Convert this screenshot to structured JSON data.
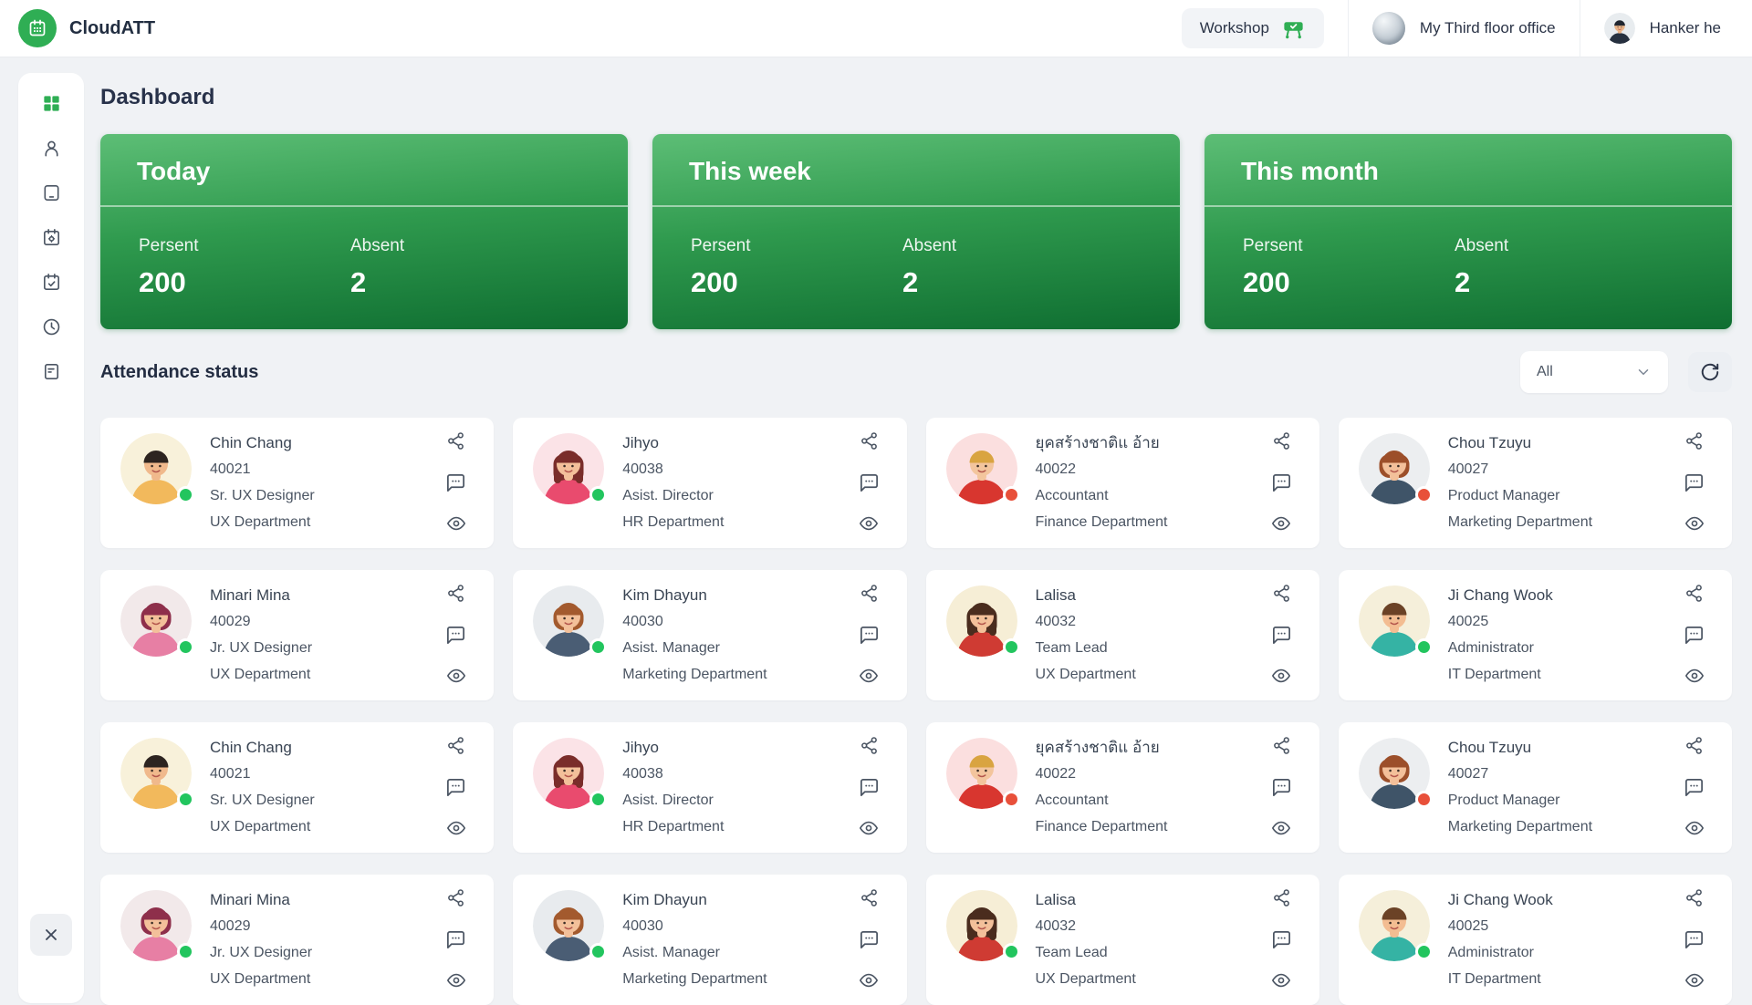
{
  "header": {
    "brand": "CloudATT",
    "workshop_label": "Workshop",
    "office_label": "My Third floor office",
    "user_name": "Hanker he",
    "user_avatar": {
      "bg": "#e8ecef",
      "hair": "#20262f",
      "skin": "#eab489",
      "shirt": "#26303f",
      "style": "short"
    }
  },
  "sidebar": {
    "items": [
      {
        "name": "dashboard",
        "icon": "grid-icon",
        "active": true
      },
      {
        "name": "employees",
        "icon": "user-icon",
        "active": false
      },
      {
        "name": "devices",
        "icon": "tablet-icon",
        "active": false
      },
      {
        "name": "schedule-settings",
        "icon": "calendar-gear-icon",
        "active": false
      },
      {
        "name": "attendance-calendar",
        "icon": "calendar-check-icon",
        "active": false
      },
      {
        "name": "time-log",
        "icon": "clock-icon",
        "active": false
      },
      {
        "name": "reports",
        "icon": "report-icon",
        "active": false
      }
    ],
    "collapse_icon": "close-icon"
  },
  "page_title": "Dashboard",
  "summary_cards": [
    {
      "title": "Today",
      "present_label": "Persent",
      "present_value": "200",
      "absent_label": "Absent",
      "absent_value": "2"
    },
    {
      "title": "This week",
      "present_label": "Persent",
      "present_value": "200",
      "absent_label": "Absent",
      "absent_value": "2"
    },
    {
      "title": "This month",
      "present_label": "Persent",
      "present_value": "200",
      "absent_label": "Absent",
      "absent_value": "2"
    }
  ],
  "attendance": {
    "title": "Attendance status",
    "filter_value": "All",
    "employees": [
      {
        "name": "Chin Chang",
        "id": "40021",
        "role": "Sr. UX Designer",
        "dept": "UX Department",
        "status": "present",
        "avatar": {
          "bg": "#f8f1da",
          "hair": "#2d2420",
          "skin": "#f0b98c",
          "shirt": "#f2b95c",
          "style": "short"
        }
      },
      {
        "name": "Jihyo",
        "id": "40038",
        "role": "Asist. Director",
        "dept": "HR Department",
        "status": "present",
        "avatar": {
          "bg": "#fbe3e7",
          "hair": "#7a2d2a",
          "skin": "#f3c09a",
          "shirt": "#e94b6e",
          "style": "long"
        }
      },
      {
        "name": "ยุคสร้างชาติแ อ้าย",
        "id": "40022",
        "role": "Accountant",
        "dept": "Finance Department",
        "status": "absent",
        "avatar": {
          "bg": "#fbdfdf",
          "hair": "#d9a441",
          "skin": "#f3c59d",
          "shirt": "#d8362f",
          "style": "short"
        }
      },
      {
        "name": "Chou Tzuyu",
        "id": "40027",
        "role": "Product Manager",
        "dept": "Marketing Department",
        "status": "absent",
        "avatar": {
          "bg": "#eceef0",
          "hair": "#9c4f2a",
          "skin": "#f3c09a",
          "shirt": "#3f5468",
          "style": "bob"
        }
      },
      {
        "name": "Minari Mina",
        "id": "40029",
        "role": "Jr. UX Designer",
        "dept": "UX Department",
        "status": "present",
        "avatar": {
          "bg": "#f2e9ea",
          "hair": "#8e2f4b",
          "skin": "#f3c09a",
          "shirt": "#e77fa4",
          "style": "bob"
        }
      },
      {
        "name": "Kim Dhayun",
        "id": "40030",
        "role": "Asist. Manager",
        "dept": "Marketing Department",
        "status": "present",
        "avatar": {
          "bg": "#e8ebee",
          "hair": "#a35a2e",
          "skin": "#f3c09a",
          "shirt": "#4a5d74",
          "style": "bob"
        }
      },
      {
        "name": "Lalisa",
        "id": "40032",
        "role": "Team Lead",
        "dept": "UX Department",
        "status": "present",
        "avatar": {
          "bg": "#f6eed6",
          "hair": "#4a2c1e",
          "skin": "#f3c09a",
          "shirt": "#cf3b33",
          "style": "long"
        }
      },
      {
        "name": "Ji Chang Wook",
        "id": "40025",
        "role": "Administrator",
        "dept": "IT Department",
        "status": "present",
        "avatar": {
          "bg": "#f5efda",
          "hair": "#6b4226",
          "skin": "#f3bd92",
          "shirt": "#35b3a4",
          "style": "short"
        }
      },
      {
        "name": "Chin Chang",
        "id": "40021",
        "role": "Sr. UX Designer",
        "dept": "UX Department",
        "status": "present",
        "avatar": {
          "bg": "#f8f1da",
          "hair": "#2d2420",
          "skin": "#f0b98c",
          "shirt": "#f2b95c",
          "style": "short"
        }
      },
      {
        "name": "Jihyo",
        "id": "40038",
        "role": "Asist. Director",
        "dept": "HR Department",
        "status": "present",
        "avatar": {
          "bg": "#fbe3e7",
          "hair": "#7a2d2a",
          "skin": "#f3c09a",
          "shirt": "#e94b6e",
          "style": "long"
        }
      },
      {
        "name": "ยุคสร้างชาติแ อ้าย",
        "id": "40022",
        "role": "Accountant",
        "dept": "Finance Department",
        "status": "absent",
        "avatar": {
          "bg": "#fbdfdf",
          "hair": "#d9a441",
          "skin": "#f3c59d",
          "shirt": "#d8362f",
          "style": "short"
        }
      },
      {
        "name": "Chou Tzuyu",
        "id": "40027",
        "role": "Product Manager",
        "dept": "Marketing Department",
        "status": "absent",
        "avatar": {
          "bg": "#eceef0",
          "hair": "#9c4f2a",
          "skin": "#f3c09a",
          "shirt": "#3f5468",
          "style": "bob"
        }
      },
      {
        "name": "Minari Mina",
        "id": "40029",
        "role": "Jr. UX Designer",
        "dept": "UX Department",
        "status": "present",
        "avatar": {
          "bg": "#f2e9ea",
          "hair": "#8e2f4b",
          "skin": "#f3c09a",
          "shirt": "#e77fa4",
          "style": "bob"
        }
      },
      {
        "name": "Kim Dhayun",
        "id": "40030",
        "role": "Asist. Manager",
        "dept": "Marketing Department",
        "status": "present",
        "avatar": {
          "bg": "#e8ebee",
          "hair": "#a35a2e",
          "skin": "#f3c09a",
          "shirt": "#4a5d74",
          "style": "bob"
        }
      },
      {
        "name": "Lalisa",
        "id": "40032",
        "role": "Team Lead",
        "dept": "UX Department",
        "status": "present",
        "avatar": {
          "bg": "#f6eed6",
          "hair": "#4a2c1e",
          "skin": "#f3c09a",
          "shirt": "#cf3b33",
          "style": "long"
        }
      },
      {
        "name": "Ji Chang Wook",
        "id": "40025",
        "role": "Administrator",
        "dept": "IT Department",
        "status": "present",
        "avatar": {
          "bg": "#f5efda",
          "hair": "#6b4226",
          "skin": "#f3bd92",
          "shirt": "#35b3a4",
          "style": "short"
        }
      }
    ]
  },
  "colors": {
    "accent_green": "#2fae54",
    "card_gradient_top": "#5dbe76",
    "card_gradient_bottom": "#0f6e31",
    "status_present": "#22c55e",
    "status_absent": "#e8503a",
    "icon_slate": "#4b5563",
    "text_dark": "#232d42"
  }
}
